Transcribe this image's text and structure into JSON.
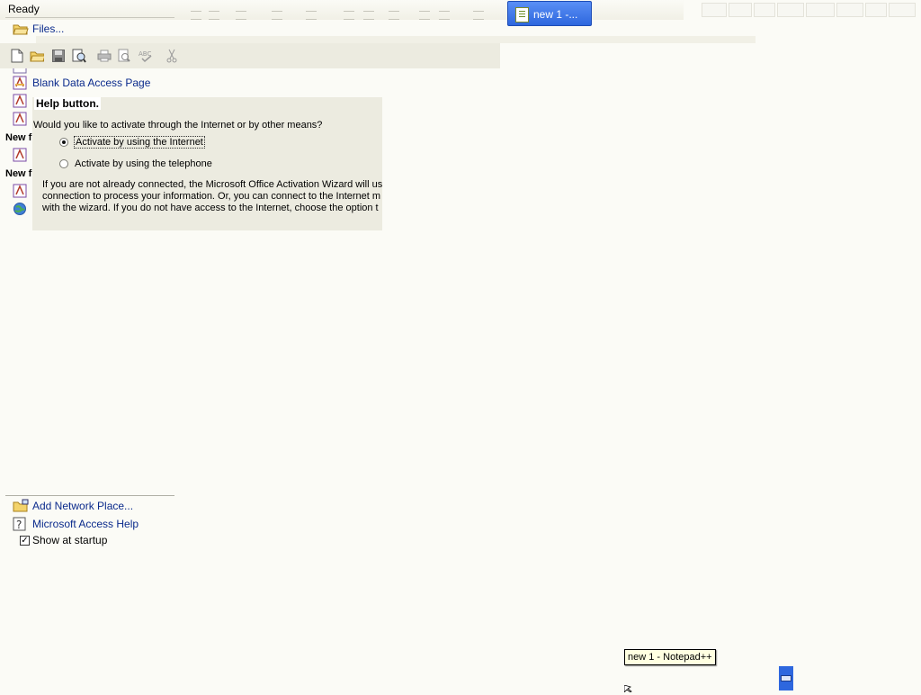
{
  "status": {
    "text": "Ready"
  },
  "taskbar": {
    "task_button_label": "new 1 -..."
  },
  "task_pane": {
    "open_files_link": "Files...",
    "blank_data_access_page": "Blank Data Access Page",
    "section_new_from_1": "New f",
    "section_new_from_2": "New f",
    "add_network_place": "Add Network Place...",
    "access_help": "Microsoft Access Help",
    "show_at_startup": "Show at startup",
    "show_at_startup_checked": true
  },
  "dialog": {
    "heading": "Help button.",
    "question": "Would you like to activate through the Internet or by other means?",
    "option_internet": "Activate by using the Internet",
    "option_telephone": "Activate by using the telephone",
    "selected": "internet",
    "body_line1": "If you are not already connected, the Microsoft Office Activation Wizard will us",
    "body_line2": "connection to process your information. Or, you can connect to the Internet m",
    "body_line3": "with the wizard. If you do not have access to the Internet, choose the option t"
  },
  "tooltip": {
    "text": "new 1 - Notepad++"
  },
  "colors": {
    "background": "#fbfbf6",
    "link": "#0a2a8c",
    "taskbar_blue": "#2e67de",
    "dialog_bg": "#ecebe0"
  }
}
